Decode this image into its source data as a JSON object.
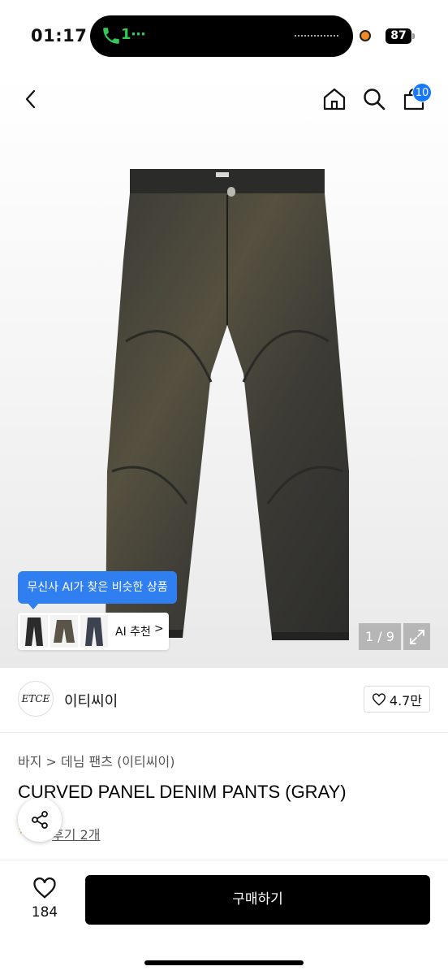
{
  "status_bar": {
    "time": "01:17",
    "call_text": "1⋯",
    "battery": "87"
  },
  "header": {
    "cart_count": "10",
    "icons": [
      "back-icon",
      "home-icon",
      "search-icon",
      "shopping-bag-icon"
    ]
  },
  "gallery": {
    "counter": "1 / 9",
    "ai_tooltip": "무신사 AI가 찾은 비슷한 상품",
    "ai_label": "AI 추천",
    "ai_chevron": ">"
  },
  "brand": {
    "logo_text": "ETCE",
    "name": "이티씨이",
    "likes": "4.7만"
  },
  "product": {
    "breadcrumb": "바지 > 데님 팬츠 (이티씨이)",
    "title": "CURVED PANEL DENIM PANTS (GRAY)",
    "review_link": "후기 2개"
  },
  "bottom_bar": {
    "wish_count": "184",
    "buy_label": "구매하기"
  },
  "colors": {
    "accent_blue": "#2f7ff0",
    "badge_blue": "#1677ff",
    "buy_button": "#000000"
  }
}
